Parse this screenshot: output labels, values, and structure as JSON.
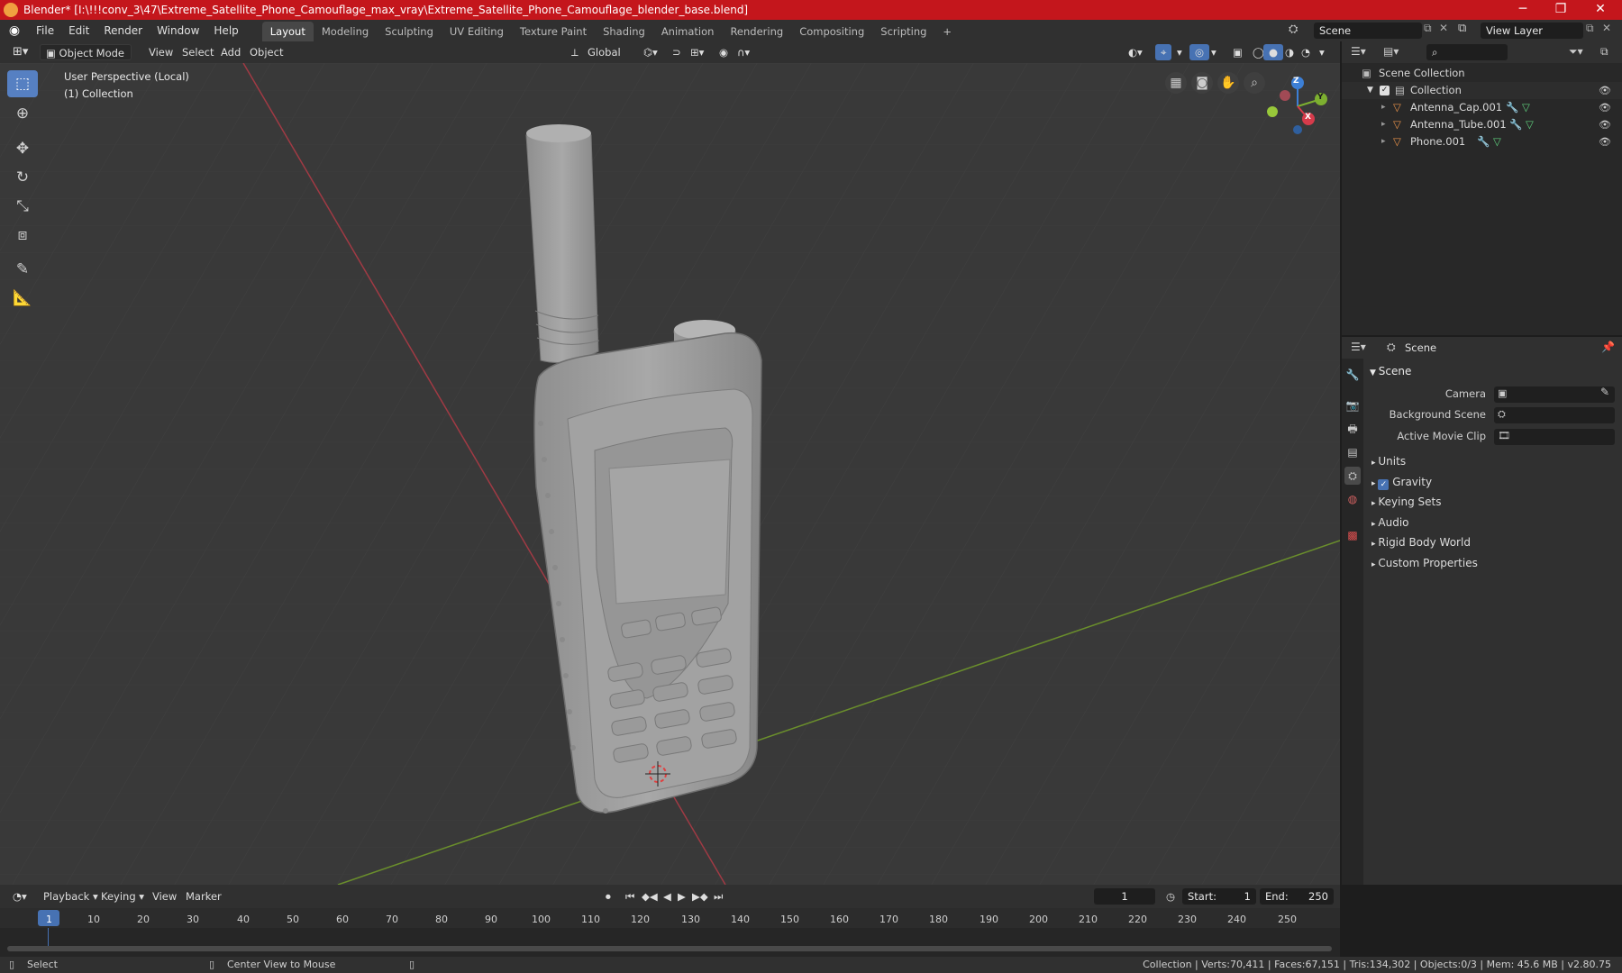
{
  "window": {
    "title": "Blender* [I:\\!!!conv_3\\47\\Extreme_Satellite_Phone_Camouflage_max_vray\\Extreme_Satellite_Phone_Camouflage_blender_base.blend]",
    "minimize": "─",
    "maximize": "❐",
    "close": "✕"
  },
  "menu": {
    "items": [
      "File",
      "Edit",
      "Render",
      "Window",
      "Help"
    ],
    "workspaces": [
      "Layout",
      "Modeling",
      "Sculpting",
      "UV Editing",
      "Texture Paint",
      "Shading",
      "Animation",
      "Rendering",
      "Compositing",
      "Scripting"
    ],
    "active_workspace": "Layout",
    "add_workspace": "+",
    "scene": "Scene",
    "view_layer": "View Layer"
  },
  "viewport_header": {
    "mode": "Object Mode",
    "menus": [
      "View",
      "Select",
      "Add",
      "Object"
    ],
    "transform_orientation": "Global"
  },
  "viewport": {
    "perspective_label": "User Perspective (Local)",
    "collection_label": "(1) Collection",
    "gizmo": {
      "x": "X",
      "y": "Y",
      "z": "Z"
    }
  },
  "outliner": {
    "root": "Scene Collection",
    "collection": "Collection",
    "objects": [
      "Antenna_Cap.001",
      "Antenna_Tube.001",
      "Phone.001"
    ]
  },
  "properties": {
    "header": "Scene",
    "panel_title": "Scene",
    "fields": {
      "camera": "Camera",
      "background_scene": "Background Scene",
      "active_movie_clip": "Active Movie Clip"
    },
    "sections": [
      "Units",
      "Gravity",
      "Keying Sets",
      "Audio",
      "Rigid Body World",
      "Custom Properties"
    ],
    "gravity_checked": true
  },
  "timeline": {
    "menus": [
      "Playback",
      "Keying",
      "View",
      "Marker"
    ],
    "current_frame": "1",
    "start_label": "Start:",
    "start": "1",
    "end_label": "End:",
    "end": "250",
    "ruler": [
      "1",
      "10",
      "20",
      "30",
      "40",
      "50",
      "60",
      "70",
      "80",
      "90",
      "100",
      "110",
      "120",
      "130",
      "140",
      "150",
      "160",
      "170",
      "180",
      "190",
      "200",
      "210",
      "220",
      "230",
      "240",
      "250"
    ]
  },
  "statusbar": {
    "select": "Select",
    "center_view": "Center View to Mouse",
    "stats": "Collection | Verts:70,411 | Faces:67,151 | Tris:134,302 | Objects:0/3 | Mem: 45.6 MB | v2.80.75"
  },
  "colors": {
    "title_bar": "#c4161c",
    "accent": "#5680c2",
    "x_axis": "#d63b4b",
    "y_axis": "#7db030",
    "z_axis": "#3c7fd6"
  }
}
